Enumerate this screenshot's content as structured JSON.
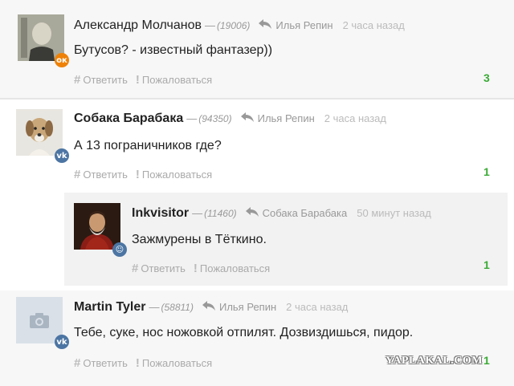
{
  "comments": [
    {
      "author": "Александр Молчанов",
      "rating": "(19006)",
      "reply_to": "Илья Репин",
      "time": "2 часа назад",
      "text": "Бутусов? - известный фантазер))",
      "reply_label": "Ответить",
      "report_label": "Пожаловаться",
      "score": "3",
      "badge": "ok",
      "avatar_icon": "portrait-photo"
    },
    {
      "author": "Собака Барабака",
      "rating": "(94350)",
      "reply_to": "Илья Репин",
      "time": "2 часа назад",
      "text": "А 13 пограничников где?",
      "reply_label": "Ответить",
      "report_label": "Пожаловаться",
      "score": "1",
      "badge": "vk",
      "avatar_icon": "dog-photo"
    },
    {
      "author": "Inkvisitor",
      "rating": "(11460)",
      "reply_to": "Собака Барабака",
      "time": "50 минут назад",
      "text": "Зажмурены в Тёткино.",
      "reply_label": "Ответить",
      "report_label": "Пожаловаться",
      "score": "1",
      "badge": "smile",
      "avatar_icon": "painting-portrait"
    },
    {
      "author": "Martin Tyler",
      "rating": "(58811)",
      "reply_to": "Илья Репин",
      "time": "2 часа назад",
      "text": "Тебе, суке, нос ножовкой отпилят. Дозвиздишься, пидор.",
      "reply_label": "Ответить",
      "report_label": "Пожаловаться",
      "score": "1",
      "badge": "vk",
      "avatar_icon": "camera-placeholder"
    }
  ],
  "symbols": {
    "hash": "#",
    "excl": "!",
    "dash": "—",
    "ok": "ок",
    "vk": "vk",
    "smile": "☺"
  },
  "watermark": "YAPLAKAL.COM",
  "colors": {
    "score_green": "#3aaa35",
    "vk_blue": "#4c75a3",
    "ok_orange": "#ee8208"
  }
}
